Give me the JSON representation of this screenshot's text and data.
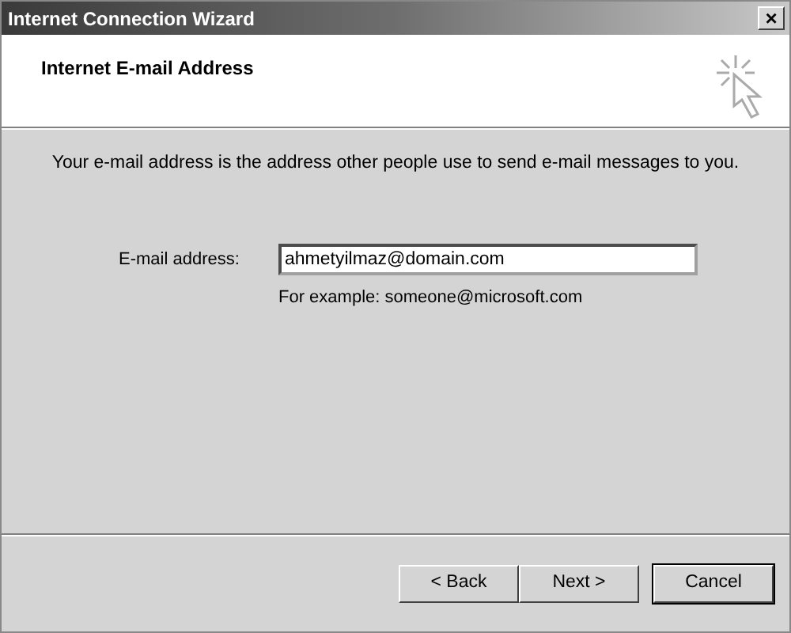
{
  "window": {
    "title": "Internet Connection Wizard",
    "close": "×"
  },
  "header": {
    "title": "Internet E-mail Address"
  },
  "intro": "Your e-mail address is the address other people use to send e-mail messages to you.",
  "field": {
    "label": "E-mail address:",
    "value": "ahmetyilmaz@domain.com"
  },
  "hint": "For example: someone@microsoft.com",
  "buttons": [
    {
      "label": "< Back",
      "default": false
    },
    {
      "label": "Next >",
      "default": false
    },
    {
      "label": "Cancel",
      "default": true
    }
  ]
}
